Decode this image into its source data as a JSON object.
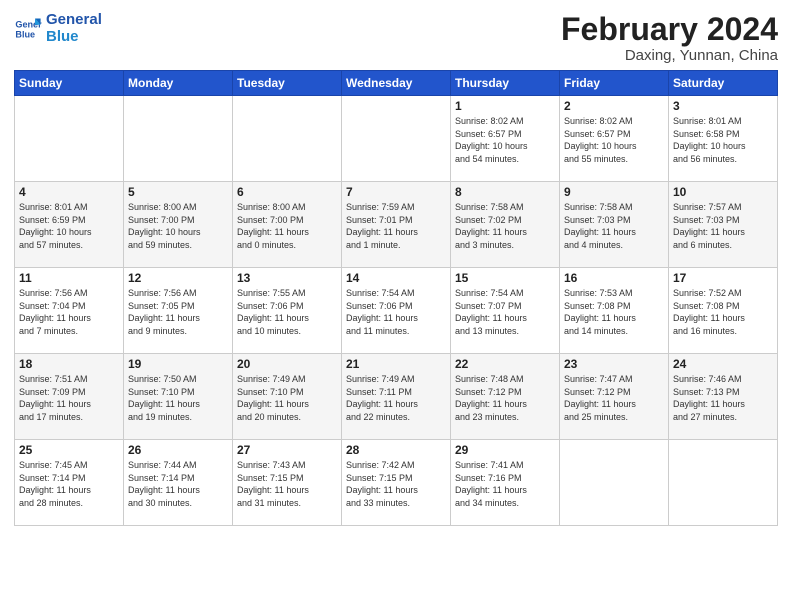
{
  "header": {
    "logo_general": "General",
    "logo_blue": "Blue",
    "month_title": "February 2024",
    "subtitle": "Daxing, Yunnan, China"
  },
  "calendar": {
    "days_of_week": [
      "Sunday",
      "Monday",
      "Tuesday",
      "Wednesday",
      "Thursday",
      "Friday",
      "Saturday"
    ],
    "weeks": [
      [
        {
          "day": "",
          "info": ""
        },
        {
          "day": "",
          "info": ""
        },
        {
          "day": "",
          "info": ""
        },
        {
          "day": "",
          "info": ""
        },
        {
          "day": "1",
          "info": "Sunrise: 8:02 AM\nSunset: 6:57 PM\nDaylight: 10 hours\nand 54 minutes."
        },
        {
          "day": "2",
          "info": "Sunrise: 8:02 AM\nSunset: 6:57 PM\nDaylight: 10 hours\nand 55 minutes."
        },
        {
          "day": "3",
          "info": "Sunrise: 8:01 AM\nSunset: 6:58 PM\nDaylight: 10 hours\nand 56 minutes."
        }
      ],
      [
        {
          "day": "4",
          "info": "Sunrise: 8:01 AM\nSunset: 6:59 PM\nDaylight: 10 hours\nand 57 minutes."
        },
        {
          "day": "5",
          "info": "Sunrise: 8:00 AM\nSunset: 7:00 PM\nDaylight: 10 hours\nand 59 minutes."
        },
        {
          "day": "6",
          "info": "Sunrise: 8:00 AM\nSunset: 7:00 PM\nDaylight: 11 hours\nand 0 minutes."
        },
        {
          "day": "7",
          "info": "Sunrise: 7:59 AM\nSunset: 7:01 PM\nDaylight: 11 hours\nand 1 minute."
        },
        {
          "day": "8",
          "info": "Sunrise: 7:58 AM\nSunset: 7:02 PM\nDaylight: 11 hours\nand 3 minutes."
        },
        {
          "day": "9",
          "info": "Sunrise: 7:58 AM\nSunset: 7:03 PM\nDaylight: 11 hours\nand 4 minutes."
        },
        {
          "day": "10",
          "info": "Sunrise: 7:57 AM\nSunset: 7:03 PM\nDaylight: 11 hours\nand 6 minutes."
        }
      ],
      [
        {
          "day": "11",
          "info": "Sunrise: 7:56 AM\nSunset: 7:04 PM\nDaylight: 11 hours\nand 7 minutes."
        },
        {
          "day": "12",
          "info": "Sunrise: 7:56 AM\nSunset: 7:05 PM\nDaylight: 11 hours\nand 9 minutes."
        },
        {
          "day": "13",
          "info": "Sunrise: 7:55 AM\nSunset: 7:06 PM\nDaylight: 11 hours\nand 10 minutes."
        },
        {
          "day": "14",
          "info": "Sunrise: 7:54 AM\nSunset: 7:06 PM\nDaylight: 11 hours\nand 11 minutes."
        },
        {
          "day": "15",
          "info": "Sunrise: 7:54 AM\nSunset: 7:07 PM\nDaylight: 11 hours\nand 13 minutes."
        },
        {
          "day": "16",
          "info": "Sunrise: 7:53 AM\nSunset: 7:08 PM\nDaylight: 11 hours\nand 14 minutes."
        },
        {
          "day": "17",
          "info": "Sunrise: 7:52 AM\nSunset: 7:08 PM\nDaylight: 11 hours\nand 16 minutes."
        }
      ],
      [
        {
          "day": "18",
          "info": "Sunrise: 7:51 AM\nSunset: 7:09 PM\nDaylight: 11 hours\nand 17 minutes."
        },
        {
          "day": "19",
          "info": "Sunrise: 7:50 AM\nSunset: 7:10 PM\nDaylight: 11 hours\nand 19 minutes."
        },
        {
          "day": "20",
          "info": "Sunrise: 7:49 AM\nSunset: 7:10 PM\nDaylight: 11 hours\nand 20 minutes."
        },
        {
          "day": "21",
          "info": "Sunrise: 7:49 AM\nSunset: 7:11 PM\nDaylight: 11 hours\nand 22 minutes."
        },
        {
          "day": "22",
          "info": "Sunrise: 7:48 AM\nSunset: 7:12 PM\nDaylight: 11 hours\nand 23 minutes."
        },
        {
          "day": "23",
          "info": "Sunrise: 7:47 AM\nSunset: 7:12 PM\nDaylight: 11 hours\nand 25 minutes."
        },
        {
          "day": "24",
          "info": "Sunrise: 7:46 AM\nSunset: 7:13 PM\nDaylight: 11 hours\nand 27 minutes."
        }
      ],
      [
        {
          "day": "25",
          "info": "Sunrise: 7:45 AM\nSunset: 7:14 PM\nDaylight: 11 hours\nand 28 minutes."
        },
        {
          "day": "26",
          "info": "Sunrise: 7:44 AM\nSunset: 7:14 PM\nDaylight: 11 hours\nand 30 minutes."
        },
        {
          "day": "27",
          "info": "Sunrise: 7:43 AM\nSunset: 7:15 PM\nDaylight: 11 hours\nand 31 minutes."
        },
        {
          "day": "28",
          "info": "Sunrise: 7:42 AM\nSunset: 7:15 PM\nDaylight: 11 hours\nand 33 minutes."
        },
        {
          "day": "29",
          "info": "Sunrise: 7:41 AM\nSunset: 7:16 PM\nDaylight: 11 hours\nand 34 minutes."
        },
        {
          "day": "",
          "info": ""
        },
        {
          "day": "",
          "info": ""
        }
      ]
    ]
  }
}
